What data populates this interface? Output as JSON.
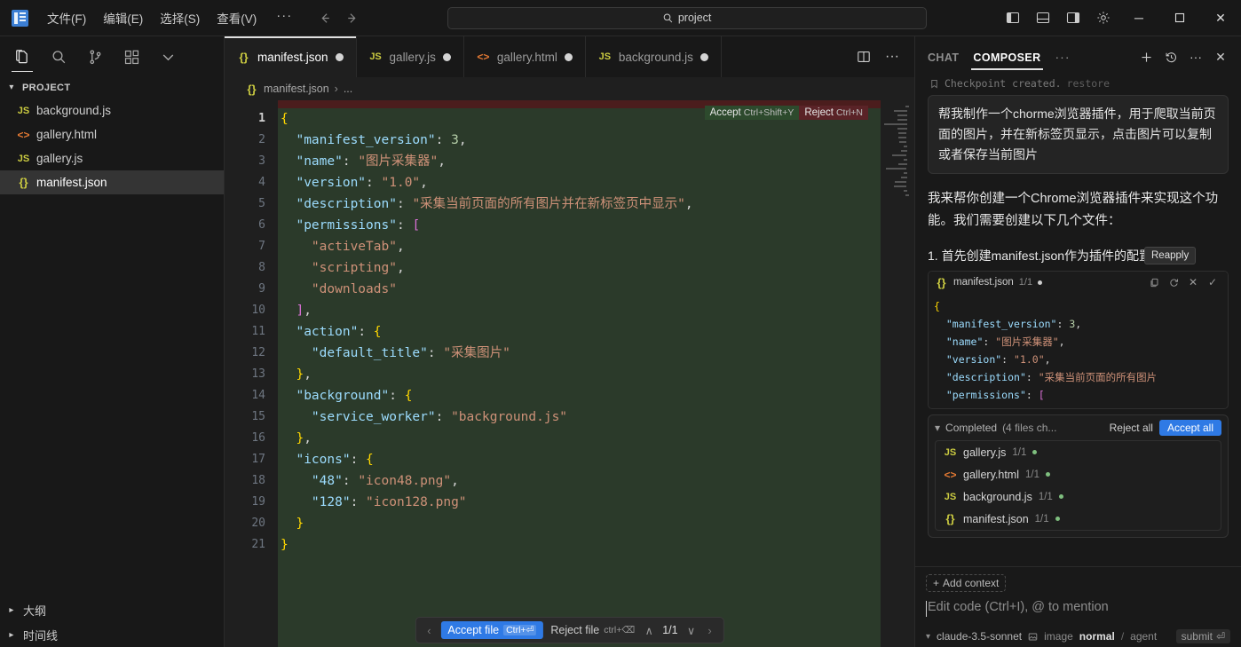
{
  "titlebar": {
    "menus": [
      "文件(F)",
      "编辑(E)",
      "选择(S)",
      "查看(V)"
    ],
    "more": "···",
    "back_icon": "arrow-left-icon",
    "forward_icon": "arrow-right-icon",
    "search_value": "project",
    "window": {
      "minimize": "─",
      "maximize": "☐",
      "close": "✕"
    }
  },
  "sidebar": {
    "section_title": "PROJECT",
    "files": [
      {
        "name": "background.js",
        "type": "js",
        "glyph": "JS"
      },
      {
        "name": "gallery.html",
        "type": "html",
        "glyph": "<>"
      },
      {
        "name": "gallery.js",
        "type": "js",
        "glyph": "JS"
      },
      {
        "name": "manifest.json",
        "type": "json",
        "glyph": "{}"
      }
    ],
    "selected": "manifest.json",
    "bottom_sections": [
      "大纲",
      "时间线"
    ]
  },
  "editor": {
    "tabs": [
      {
        "label": "manifest.json",
        "type": "json",
        "glyph": "{}",
        "active": true,
        "dirty": true
      },
      {
        "label": "gallery.js",
        "type": "js",
        "glyph": "JS",
        "active": false,
        "dirty": true
      },
      {
        "label": "gallery.html",
        "type": "html",
        "glyph": "<>",
        "active": false,
        "dirty": true
      },
      {
        "label": "background.js",
        "type": "js",
        "glyph": "JS",
        "active": false,
        "dirty": true
      }
    ],
    "breadcrumb": {
      "file": "manifest.json",
      "sep": "›",
      "tail": "..."
    },
    "inline_diff": {
      "accept_label": "Accept",
      "accept_key": "Ctrl+Shift+Y",
      "reject_label": "Reject",
      "reject_key": "Ctrl+N"
    },
    "line_count": 21,
    "code_lines": [
      "{",
      "  \"manifest_version\": 3,",
      "  \"name\": \"图片采集器\",",
      "  \"version\": \"1.0\",",
      "  \"description\": \"采集当前页面的所有图片并在新标签页中显示\",",
      "  \"permissions\": [",
      "    \"activeTab\",",
      "    \"scripting\",",
      "    \"downloads\"",
      "  ],",
      "  \"action\": {",
      "    \"default_title\": \"采集图片\"",
      "  },",
      "  \"background\": {",
      "    \"service_worker\": \"background.js\"",
      "  },",
      "  \"icons\": {",
      "    \"48\": \"icon48.png\",",
      "    \"128\": \"icon128.png\"",
      "  }",
      "}"
    ],
    "diff_toolbar": {
      "prev": "‹",
      "accept_file": "Accept file",
      "accept_key": "Ctrl+⏎",
      "reject_file": "Reject file",
      "reject_key": "ctrl+⌫",
      "up": "∧",
      "count": "1/1",
      "down": "∨",
      "next": "›"
    }
  },
  "panel": {
    "tabs": [
      {
        "label": "CHAT",
        "active": false
      },
      {
        "label": "COMPOSER",
        "active": true
      }
    ],
    "tab_more": "···",
    "actions": [
      "new-chat-icon",
      "history-icon",
      "more-icon",
      "close-icon"
    ],
    "checkpoint": {
      "text": "Checkpoint created.",
      "restore": "restore"
    },
    "user_message": "帮我制作一个chorme浏览器插件，用于爬取当前页面的图片，并在新标签页显示，点击图片可以复制或者保存当前图片",
    "assistant_message": "我来帮你创建一个Chrome浏览器插件来实现这个功能。我们需要创建以下几个文件：",
    "step_text": "1. 首先创建manifest.json作为插件的配置文件：",
    "tooltip": "Reapply",
    "code_card": {
      "filename": "manifest.json",
      "count": "1/1",
      "actions": [
        "copy-icon",
        "reapply-icon",
        "reject-icon",
        "accept-icon"
      ],
      "lines": [
        "{",
        "  \"manifest_version\": 3,",
        "  \"name\": \"图片采集器\",",
        "  \"version\": \"1.0\",",
        "  \"description\": \"采集当前页面的所有图片",
        "  \"permissions\": ["
      ]
    },
    "completed": {
      "label": "Completed",
      "detail": "(4 files ch...",
      "reject_all": "Reject all",
      "accept_all": "Accept all",
      "files": [
        {
          "name": "gallery.js",
          "type": "js",
          "glyph": "JS",
          "count": "1/1"
        },
        {
          "name": "gallery.html",
          "type": "html",
          "glyph": "<>",
          "count": "1/1"
        },
        {
          "name": "background.js",
          "type": "js",
          "glyph": "JS",
          "count": "1/1"
        },
        {
          "name": "manifest.json",
          "type": "json",
          "glyph": "{}",
          "count": "1/1"
        }
      ]
    },
    "input": {
      "add_context": "Add context",
      "placeholder": "Edit code (Ctrl+I), @ to mention",
      "model": "claude-3.5-sonnet",
      "image_label": "image",
      "mode": "normal",
      "mode_sep": "/",
      "mode_alt": "agent",
      "submit": "submit",
      "submit_key": "⏎"
    }
  },
  "colors": {
    "accent": "#2f7ae5",
    "diff_added_bg": "#2b3a2a",
    "diff_removed_bg": "#4b1d1d",
    "accept_green": "#2d4a2d",
    "reject_red": "#5a2327"
  }
}
